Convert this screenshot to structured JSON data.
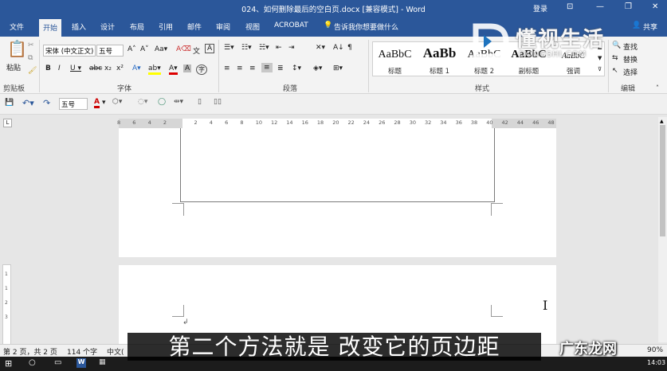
{
  "window": {
    "title": "024、如何删除最后的空白页.docx [兼容模式] - Word",
    "login": "登录"
  },
  "tabs": [
    "文件",
    "开始",
    "插入",
    "设计",
    "布局",
    "引用",
    "邮件",
    "审阅",
    "视图",
    "ACROBAT"
  ],
  "tell_me": "告诉我你想要做什么",
  "share": "共享",
  "ribbon": {
    "paste": "粘贴",
    "clipboard": "剪贴板",
    "font_name": "宋体 (中文正文)",
    "font_size": "五号",
    "font_group": "字体",
    "paragraph_group": "段落",
    "styles_group": "样式",
    "editing_group": "编辑",
    "find": "查找",
    "replace": "替换",
    "select": "选择",
    "styles": [
      {
        "preview": "AaBbC",
        "name": "标题"
      },
      {
        "preview": "AaBb",
        "name": "标题 1"
      },
      {
        "preview": "AaBbC",
        "name": "标题 2"
      },
      {
        "preview": "AaBbC",
        "name": "副标题"
      },
      {
        "preview": "AaBbC",
        "name": "强调"
      }
    ]
  },
  "qat": {
    "font_size": "五号"
  },
  "ruler_ticks": [
    "8",
    "6",
    "4",
    "2",
    "",
    "2",
    "4",
    "6",
    "8",
    "10",
    "12",
    "14",
    "16",
    "18",
    "20",
    "22",
    "24",
    "26",
    "28",
    "30",
    "32",
    "34",
    "36",
    "38",
    "40",
    "42",
    "44",
    "46",
    "48"
  ],
  "left_ruler_ticks": [
    "1",
    "1",
    "2",
    "3"
  ],
  "status": {
    "page": "第 2 页，共 2 页",
    "words": "114 个字",
    "lang": "中文(",
    "zoom": "90%"
  },
  "taskbar": {
    "time": "14:03"
  },
  "subtitle": "第二个方法就是 改变它的页边距",
  "watermark": {
    "brand_cn": "懂视生活",
    "brand_url": "DONGSHI.COM"
  },
  "brand_overlay": "广东龙网"
}
